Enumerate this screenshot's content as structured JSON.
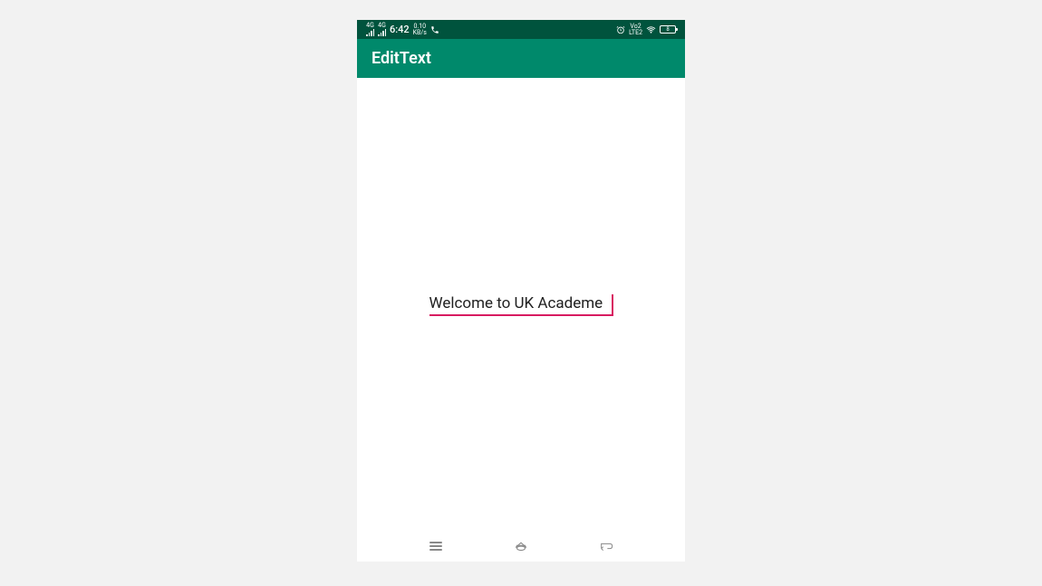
{
  "status_bar": {
    "signal1_label": "4G",
    "signal2_label": "4G",
    "time": "6:42",
    "data_rate_value": "0.10",
    "data_rate_unit": "KB/s",
    "lte_label_top": "Vo2",
    "lte_label_bottom": "LTE2",
    "battery_level": "8"
  },
  "app_bar": {
    "title": "EditText"
  },
  "content": {
    "edit_text_value": "Welcome to UK Academe"
  },
  "colors": {
    "status_bar_bg": "#00533d",
    "app_bar_bg": "#00896b",
    "accent": "#d81b60"
  }
}
